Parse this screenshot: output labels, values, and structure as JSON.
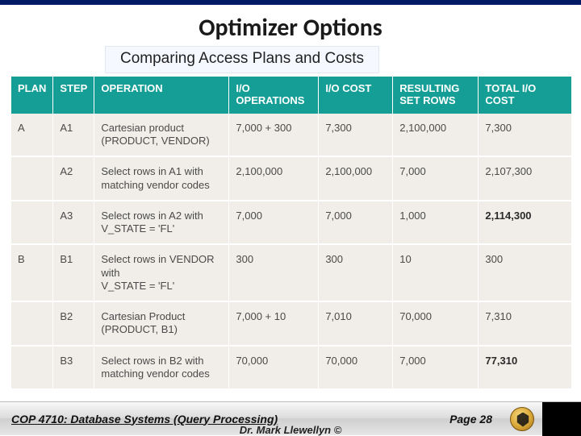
{
  "title": "Optimizer Options",
  "subtitle": "Comparing Access Plans and Costs",
  "headers": {
    "plan": "PLAN",
    "step": "STEP",
    "operation": "OPERATION",
    "io_ops": "I/O\nOPERATIONS",
    "io_cost": "I/O COST",
    "rows": "RESULTING\nSET ROWS",
    "total": "TOTAL I/O\nCOST"
  },
  "rows": [
    {
      "plan": "A",
      "step": "A1",
      "operation": "Cartesian product\n(PRODUCT, VENDOR)",
      "io_ops": "7,000 + 300",
      "io_cost": "7,300",
      "rows": "2,100,000",
      "total": "7,300",
      "total_bold": false
    },
    {
      "plan": "",
      "step": "A2",
      "operation": "Select rows in A1 with\nmatching vendor codes",
      "io_ops": "2,100,000",
      "io_cost": "2,100,000",
      "rows": "7,000",
      "total": "2,107,300",
      "total_bold": false
    },
    {
      "plan": "",
      "step": "A3",
      "operation": "Select rows in A2 with\nV_STATE = 'FL'",
      "io_ops": "7,000",
      "io_cost": "7,000",
      "rows": "1,000",
      "total": "2,114,300",
      "total_bold": true
    },
    {
      "plan": "B",
      "step": "B1",
      "operation": "Select rows in VENDOR with\nV_STATE = 'FL'",
      "io_ops": "300",
      "io_cost": "300",
      "rows": "10",
      "total": "300",
      "total_bold": false
    },
    {
      "plan": "",
      "step": "B2",
      "operation": "Cartesian Product\n(PRODUCT, B1)",
      "io_ops": "7,000 + 10",
      "io_cost": "7,010",
      "rows": "70,000",
      "total": "7,310",
      "total_bold": false
    },
    {
      "plan": "",
      "step": "B3",
      "operation": "Select rows in B2 with\nmatching vendor codes",
      "io_ops": "70,000",
      "io_cost": "70,000",
      "rows": "7,000",
      "total": "77,310",
      "total_bold": true
    }
  ],
  "footer": {
    "course": "COP 4710: Database Systems (Query Processing)",
    "page": "Page 28",
    "byline": "Dr. Mark Llewellyn ©"
  },
  "chart_data": {
    "type": "table",
    "title": "Comparing Access Plans and Costs",
    "columns": [
      "PLAN",
      "STEP",
      "OPERATION",
      "I/O OPERATIONS",
      "I/O COST",
      "RESULTING SET ROWS",
      "TOTAL I/O COST"
    ],
    "rows": [
      [
        "A",
        "A1",
        "Cartesian product (PRODUCT, VENDOR)",
        "7,000 + 300",
        "7,300",
        "2,100,000",
        "7,300"
      ],
      [
        "",
        "A2",
        "Select rows in A1 with matching vendor codes",
        "2,100,000",
        "2,100,000",
        "7,000",
        "2,107,300"
      ],
      [
        "",
        "A3",
        "Select rows in A2 with V_STATE = 'FL'",
        "7,000",
        "7,000",
        "1,000",
        "2,114,300"
      ],
      [
        "B",
        "B1",
        "Select rows in VENDOR with V_STATE = 'FL'",
        "300",
        "300",
        "10",
        "300"
      ],
      [
        "",
        "B2",
        "Cartesian Product (PRODUCT, B1)",
        "7,000 + 10",
        "7,010",
        "70,000",
        "7,310"
      ],
      [
        "",
        "B3",
        "Select rows in B2 with matching vendor codes",
        "70,000",
        "70,000",
        "7,000",
        "77,310"
      ]
    ]
  }
}
